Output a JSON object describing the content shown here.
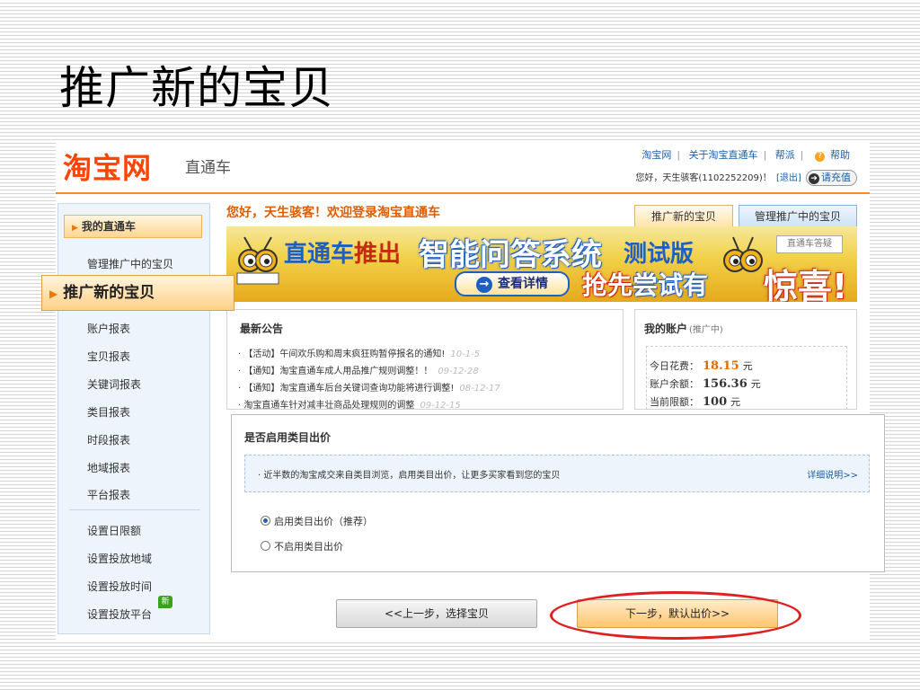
{
  "slide": {
    "title": "推广新的宝贝"
  },
  "header": {
    "logo": "淘宝网",
    "product": "直通车",
    "links": [
      "淘宝网",
      "关于淘宝直通车",
      "帮派",
      "帮助"
    ],
    "greeting": "您好，天生骇客(1102252209)！",
    "logout": "[退出]",
    "recharge": "请充值"
  },
  "sidebar": {
    "head": "我的直通车",
    "items": [
      "管理推广中的宝贝",
      "推广新的宝贝",
      "账户报表",
      "宝贝报表",
      "关键词报表",
      "类目报表",
      "时段报表",
      "地域报表",
      "平台报表"
    ],
    "settings": [
      "设置日限额",
      "设置投放地域",
      "设置投放时间",
      "设置投放平台"
    ],
    "new_badge": "新"
  },
  "main": {
    "welcome": "您好，天生骇客！欢迎登录淘宝直通车",
    "tabs": [
      "推广新的宝贝",
      "管理推广中的宝贝"
    ]
  },
  "banner": {
    "part1": "直通车",
    "part1b": "推出",
    "part2": "智能问答系统",
    "part3": "测试版",
    "button": "查看详情",
    "slogan_a": "抢先",
    "slogan_b": "尝试有",
    "big": "惊喜!",
    "tag": "直通车答疑"
  },
  "notice": {
    "title": "最新公告",
    "items": [
      {
        "text": "· 【活动】午间欢乐购和周末疯狂购暂停报名的通知!",
        "date": "10-1-5"
      },
      {
        "text": "· 【通知】淘宝直通车成人用品推广规则调整！！",
        "date": "09-12-28"
      },
      {
        "text": "· 【通知】淘宝直通车后台关键词查询功能将进行调整!",
        "date": "08-12-17"
      },
      {
        "text": "· 淘宝直通车针对减丰壮商品处理规则的调整",
        "date": "09-12-15"
      }
    ]
  },
  "account": {
    "title": "我的账户",
    "status": "(推广中)",
    "rows": [
      {
        "label": "今日花费：",
        "value": "18.15",
        "unit": "元"
      },
      {
        "label": "账户余额：",
        "value": "156.36",
        "unit": "元"
      },
      {
        "label": "当前限额：",
        "value": "100",
        "unit": "元"
      }
    ]
  },
  "panel": {
    "title": "是否启用类目出价",
    "tip": "· 近半数的淘宝成交来自类目浏览，启用类目出价，让更多买家看到您的宝贝",
    "tip_link": "详细说明>>",
    "options": [
      "启用类目出价（推荐）",
      "不启用类目出价"
    ],
    "selected_index": 0
  },
  "buttons": {
    "prev": "<<上一步，选择宝贝",
    "next": "下一步，默认出价>>"
  },
  "colors": {
    "accent": "#ff4400",
    "highlight_circle": "#e02020",
    "link": "#1a5ea8"
  }
}
